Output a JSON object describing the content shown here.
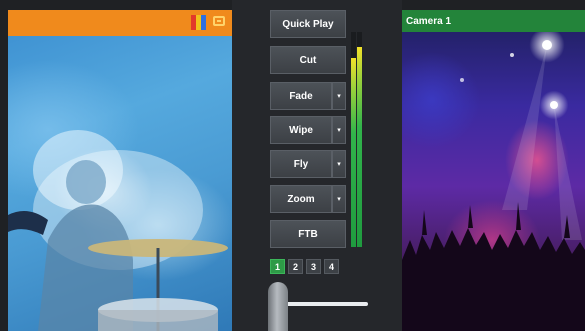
{
  "preview": {
    "header_color": "#f08a1c",
    "rgb_bars_icon": "rgb-bars-icon",
    "monitor_icon": "monitor-icon",
    "rgb_colors": [
      "#e23a2a",
      "#f2c21a",
      "#2f6fe0"
    ]
  },
  "program": {
    "title": "Camera 1",
    "header_color": "#23843a"
  },
  "transitions": {
    "quick_play": "Quick Play",
    "cut": "Cut",
    "fade": "Fade",
    "wipe": "Wipe",
    "fly": "Fly",
    "zoom": "Zoom",
    "ftb": "FTB",
    "dropdown_glyph": "▾"
  },
  "pages": [
    "1",
    "2",
    "3",
    "4"
  ],
  "active_page": "1",
  "audio_meters": {
    "left_level": 0.88,
    "right_level": 0.93
  },
  "t_bar": {
    "position": 0.0
  }
}
